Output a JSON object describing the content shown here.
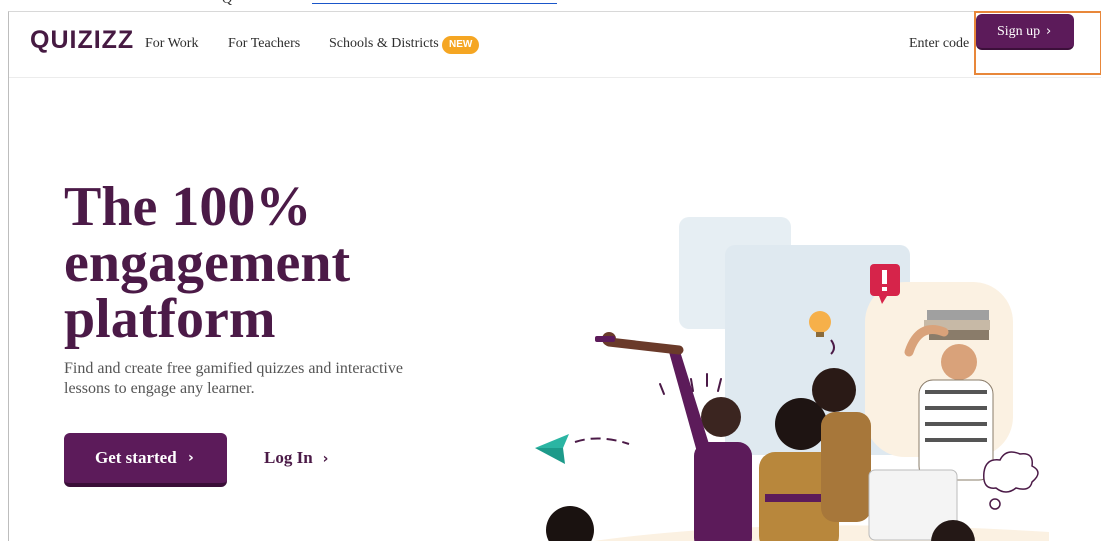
{
  "header": {
    "logo": "QUIZIZZ",
    "nav": {
      "for_work": "For Work",
      "for_teachers": "For Teachers",
      "schools_districts": "Schools & Districts",
      "new_badge": "NEW"
    },
    "enter_code": "Enter code",
    "sign_up": "Sign up",
    "chevron": "›"
  },
  "hero": {
    "title_line1": "The 100%",
    "title_line2": "engagement",
    "title_line3": "platform",
    "subtitle": "Find and create free gamified quizzes and interactive lessons to engage any learner.",
    "get_started": "Get started",
    "log_in": "Log In",
    "chevron": "›"
  },
  "colors": {
    "brand": "#5c1b5a",
    "title": "#4b1a47",
    "badge": "#f5a623",
    "highlight_outline": "#e8873a"
  },
  "illustration": {
    "icons": [
      "paper-plane-icon",
      "lightbulb-icon",
      "exclamation-bubble-icon",
      "cloud-doodle-icon"
    ]
  }
}
